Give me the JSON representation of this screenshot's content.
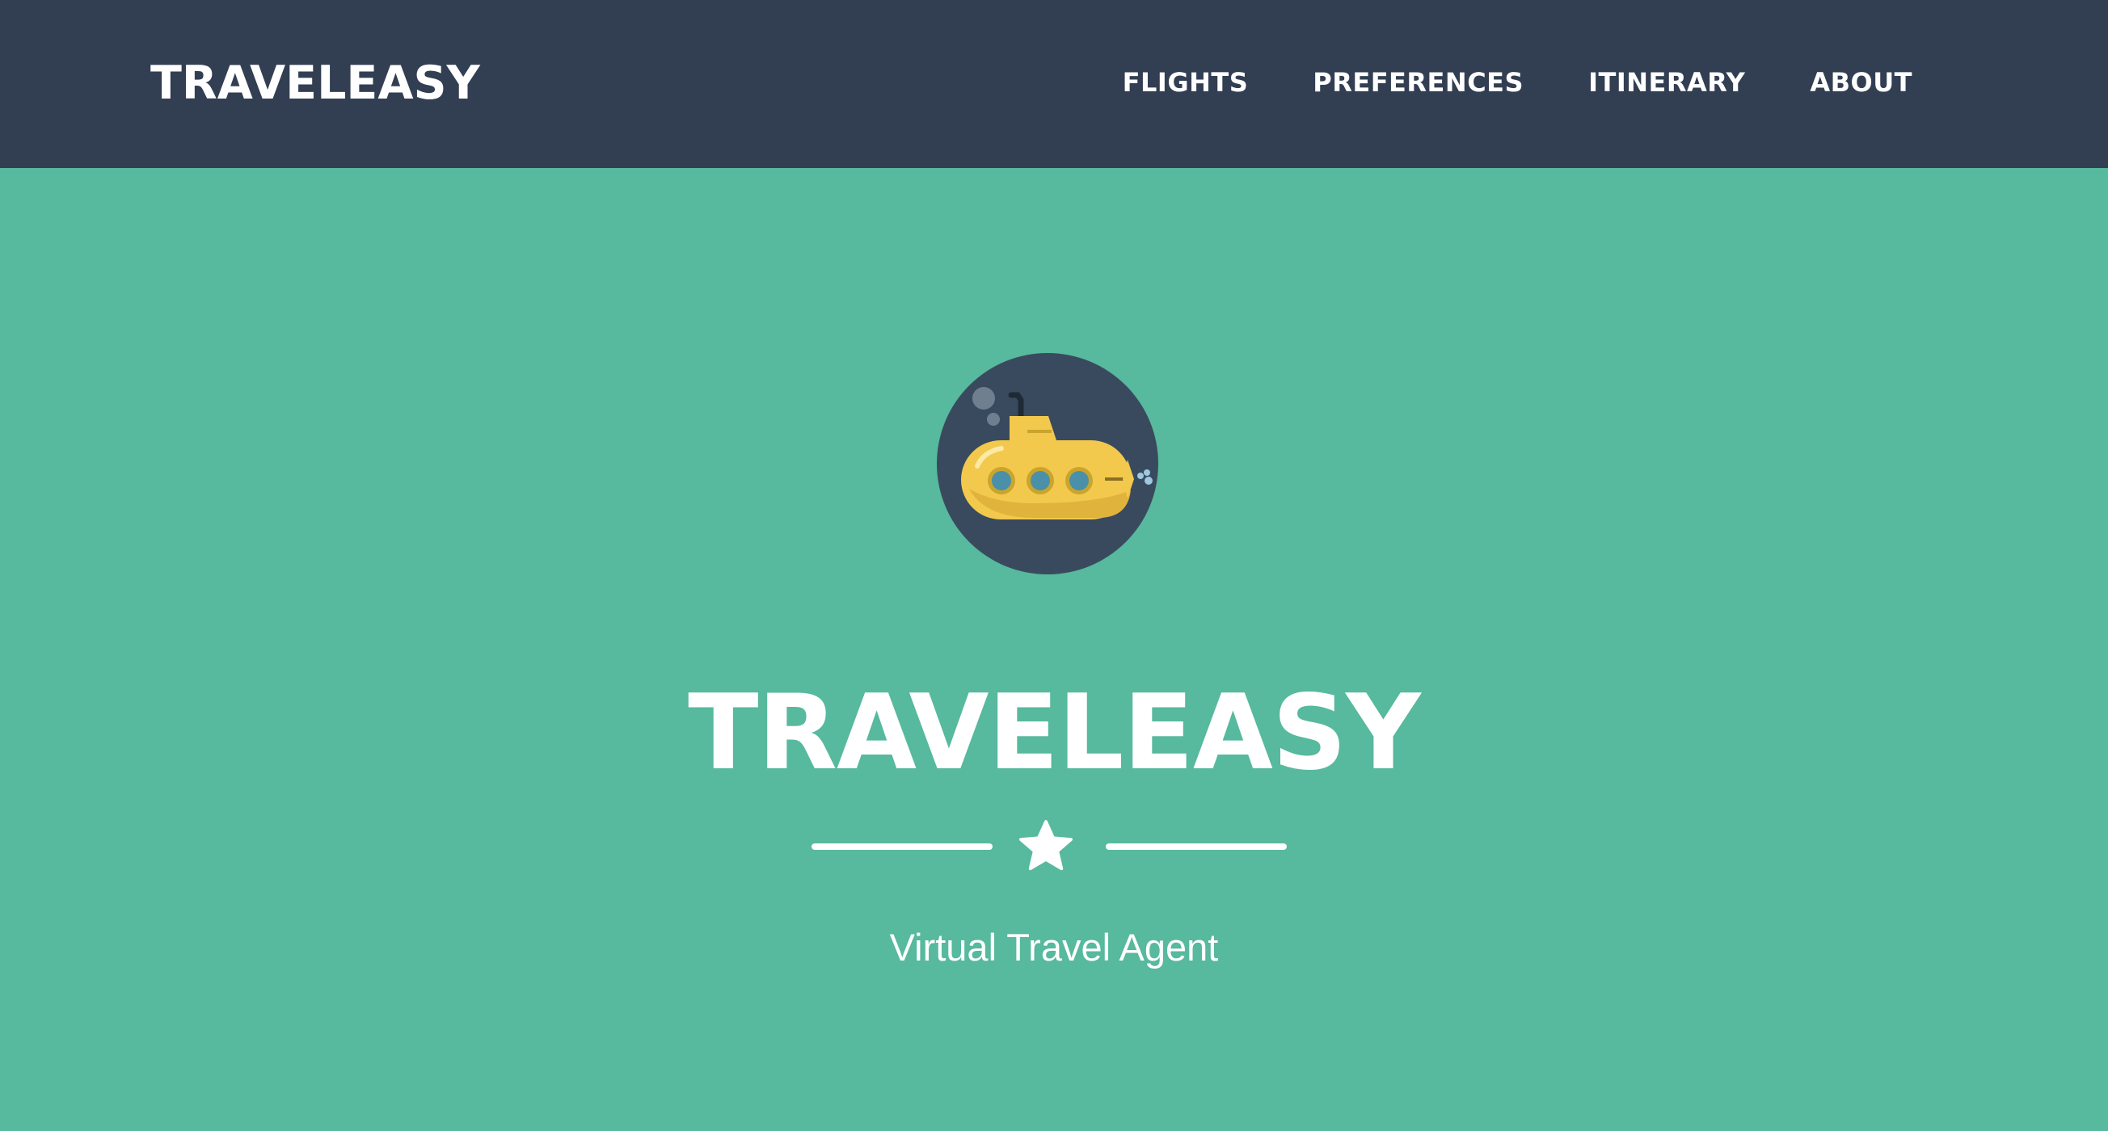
{
  "navbar": {
    "brand": "TRAVELEASY",
    "links": [
      {
        "label": "FLIGHTS"
      },
      {
        "label": "PREFERENCES"
      },
      {
        "label": "ITINERARY"
      },
      {
        "label": "ABOUT"
      }
    ]
  },
  "hero": {
    "avatar_icon": "submarine-icon",
    "title": "TRAVELEASY",
    "divider_icon": "star-icon",
    "subtitle": "Virtual Travel Agent"
  },
  "colors": {
    "navbar_bg": "#323e52",
    "hero_bg": "#57b99d",
    "text": "#ffffff",
    "avatar_bg": "#3a4a5e",
    "submarine_body": "#f2c94c",
    "porthole": "#4a90a8"
  }
}
